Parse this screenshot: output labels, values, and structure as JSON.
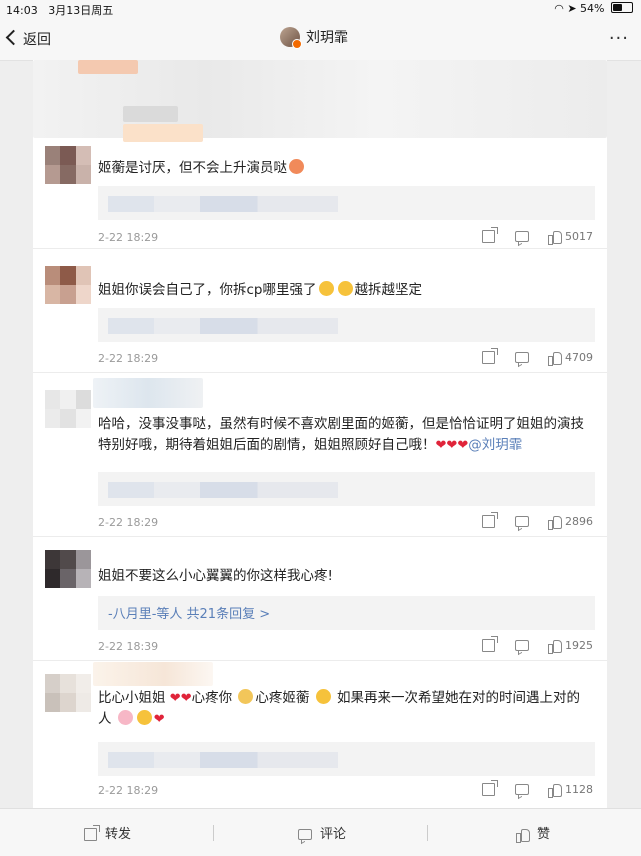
{
  "status": {
    "time": "14:03",
    "date": "3月13日周五",
    "battery": "54%",
    "battery_level": 0.54
  },
  "nav": {
    "back_label": "返回",
    "title": "刘玥霏"
  },
  "comments": [
    {
      "text": "姬蘅是讨厌，但不会上升演员哒",
      "date": "2-22 18:29",
      "likes": "5017"
    },
    {
      "text": "姐姐你误会自己了，你拆cp哪里强了",
      "text_tail": "越拆越坚定",
      "date": "2-22 18:29",
      "likes": "4709"
    },
    {
      "text": "哈哈，没事没事哒，虽然有时候不喜欢剧里面的姬蘅，但是恰恰证明了姐姐的演技特别好哦，期待着姐姐后面的剧情，姐姐照顾好自己哦！",
      "mention": "@刘玥霏",
      "date": "2-22 18:29",
      "likes": "2896"
    },
    {
      "text": "姐姐不要这么小心翼翼的你这样我心疼!",
      "reply_user": "-八月里-等人",
      "reply_link": "共21条回复 >",
      "date": "2-22 18:39",
      "likes": "1925"
    },
    {
      "text_a": "比心小姐姐",
      "text_b": "心疼你",
      "text_c": "心疼姬蘅",
      "text_d": "如果再来一次希望她在对的时间遇上对的人",
      "date": "2-22 18:29",
      "likes": "1128"
    }
  ],
  "toolbar": {
    "repost_label": "转发",
    "comment_label": "评论",
    "like_label": "赞"
  },
  "colors": {
    "accent": "#5a7fb8",
    "heart": "#e0243a"
  }
}
